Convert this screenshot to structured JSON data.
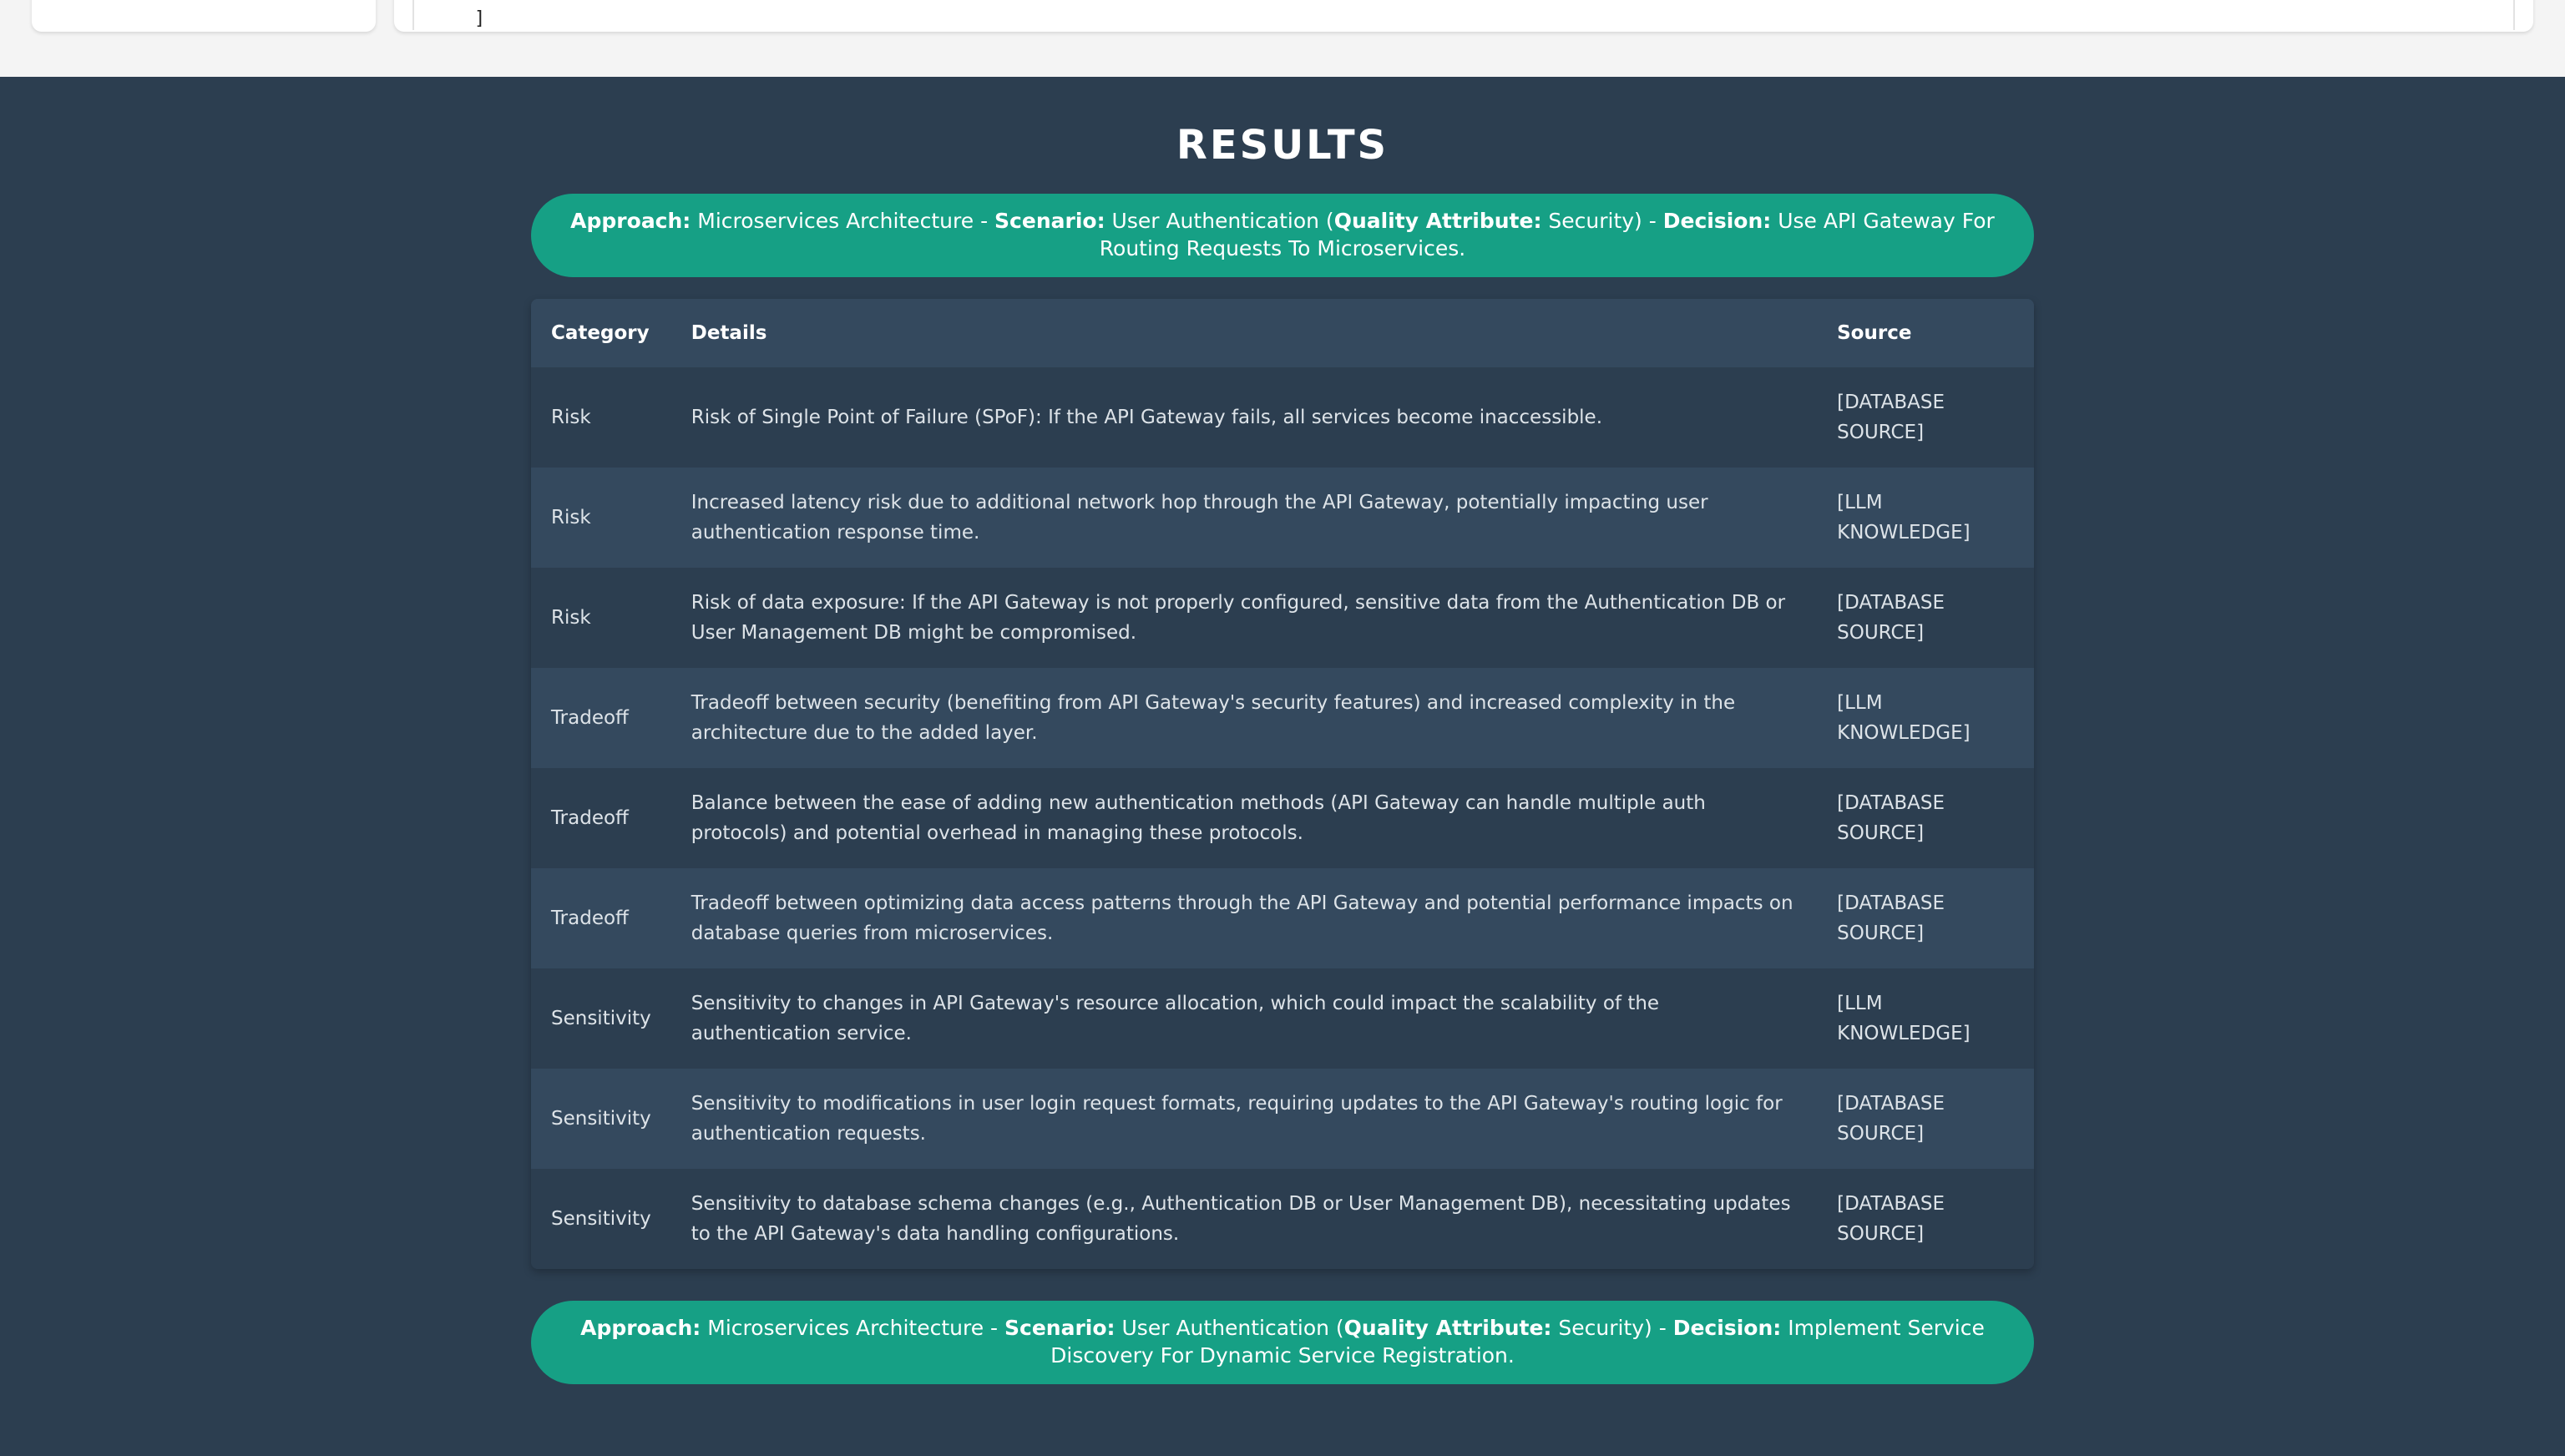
{
  "code_snippet": {
    "line_1": "}",
    "line_2": "]"
  },
  "results": {
    "title": "RESULTS",
    "banner_1": {
      "approach_label": "Approach:",
      "approach": " Microservices Architecture - ",
      "scenario_label": "Scenario:",
      "scenario": " User Authentication (",
      "quality_label": "Quality Attribute:",
      "quality": " Security) - ",
      "decision_label": "Decision:",
      "decision": " Use API Gateway For Routing Requests To Microservices."
    },
    "table": {
      "headers": [
        "Category",
        "Details",
        "Source"
      ],
      "rows": [
        {
          "category": "Risk",
          "details": "Risk of Single Point of Failure (SPoF): If the API Gateway fails, all services become inaccessible.",
          "source": "[DATABASE SOURCE]"
        },
        {
          "category": "Risk",
          "details": "Increased latency risk due to additional network hop through the API Gateway, potentially impacting user authentication response time.",
          "source": "[LLM KNOWLEDGE]"
        },
        {
          "category": "Risk",
          "details": "Risk of data exposure: If the API Gateway is not properly configured, sensitive data from the Authentication DB or User Management DB might be compromised.",
          "source": "[DATABASE SOURCE]"
        },
        {
          "category": "Tradeoff",
          "details": "Tradeoff between security (benefiting from API Gateway's security features) and increased complexity in the architecture due to the added layer.",
          "source": "[LLM KNOWLEDGE]"
        },
        {
          "category": "Tradeoff",
          "details": "Balance between the ease of adding new authentication methods (API Gateway can handle multiple auth protocols) and potential overhead in managing these protocols.",
          "source": "[DATABASE SOURCE]"
        },
        {
          "category": "Tradeoff",
          "details": "Tradeoff between optimizing data access patterns through the API Gateway and potential performance impacts on database queries from microservices.",
          "source": "[DATABASE SOURCE]"
        },
        {
          "category": "Sensitivity",
          "details": "Sensitivity to changes in API Gateway's resource allocation, which could impact the scalability of the authentication service.",
          "source": "[LLM KNOWLEDGE]"
        },
        {
          "category": "Sensitivity",
          "details": "Sensitivity to modifications in user login request formats, requiring updates to the API Gateway's routing logic for authentication requests.",
          "source": "[DATABASE SOURCE]"
        },
        {
          "category": "Sensitivity",
          "details": "Sensitivity to database schema changes (e.g., Authentication DB or User Management DB), necessitating updates to the API Gateway's data handling configurations.",
          "source": "[DATABASE SOURCE]"
        }
      ]
    },
    "banner_2": {
      "approach_label": "Approach:",
      "approach": " Microservices Architecture - ",
      "scenario_label": "Scenario:",
      "scenario": " User Authentication (",
      "quality_label": "Quality Attribute:",
      "quality": " Security) - ",
      "decision_label": "Decision:",
      "decision": " Implement Service Discovery For Dynamic Service Registration."
    }
  },
  "colors": {
    "page_background": "#2c3e50",
    "accent_banner": "#16a085",
    "table_header": "#34495e"
  }
}
